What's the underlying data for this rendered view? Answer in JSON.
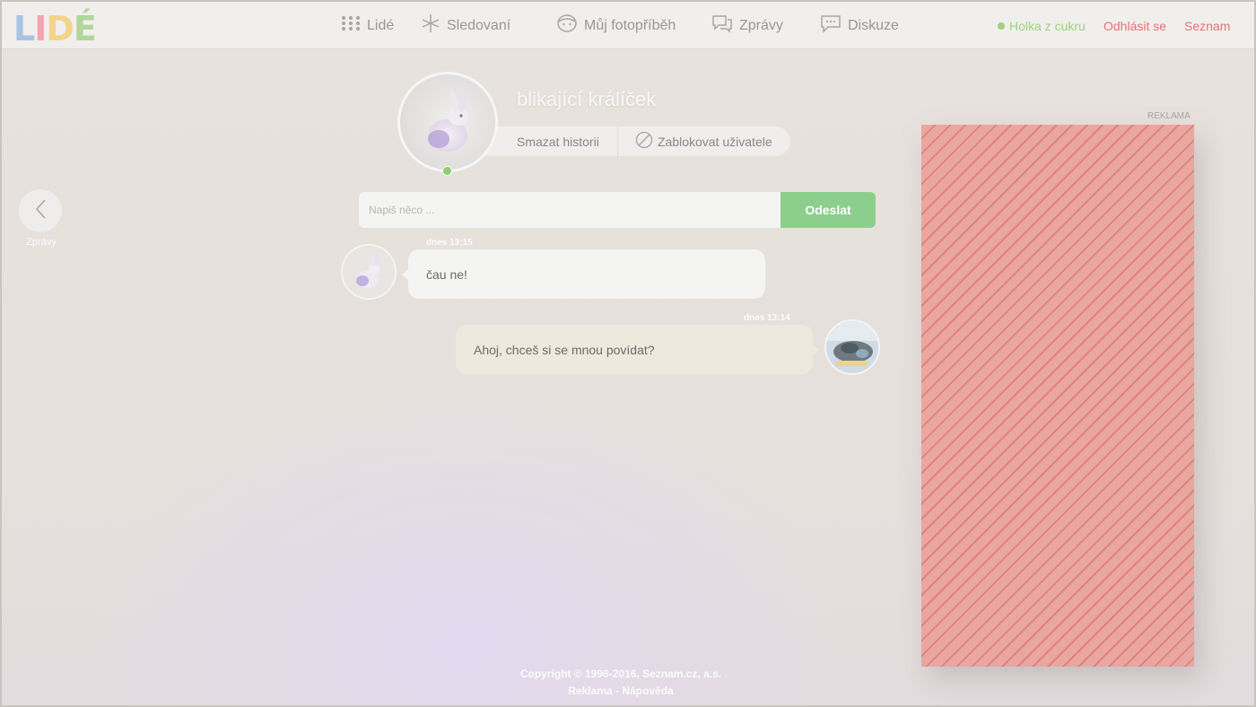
{
  "app": {
    "logo_text": "LIDÉ"
  },
  "nav": {
    "items": [
      {
        "label": "Lidé",
        "icon": "dots-grid-icon"
      },
      {
        "label": "Sledovaní",
        "icon": "star-icon"
      },
      {
        "label": "Můj fotopříběh",
        "icon": "face-icon"
      },
      {
        "label": "Zprávy",
        "icon": "chat-bubbles-icon"
      },
      {
        "label": "Diskuze",
        "icon": "discussion-icon"
      }
    ],
    "user_name": "Holka z cukru",
    "logout_label": "Odhlásit se",
    "seznam_label": "Seznam"
  },
  "back": {
    "label": "Zprávy",
    "icon": "chevron-left-icon"
  },
  "profile": {
    "name": "blikající králíček",
    "clear_history_label": "Smazat historii",
    "block_user_label": "Zablokovat uživatele",
    "block_icon": "block-icon",
    "online": true
  },
  "composer": {
    "placeholder": "Napiš něco ...",
    "send_label": "Odeslat"
  },
  "messages": [
    {
      "direction": "incoming",
      "time": "dnes 13:15",
      "text": "čau ne!"
    },
    {
      "direction": "outgoing",
      "time": "dnes 13:14",
      "text": "Ahoj, chceš si se mnou povídat?"
    }
  ],
  "ad": {
    "label": "REKLAMA"
  },
  "footer": {
    "copyright": "Copyright © 1996-2016, Seznam.cz, a.s.",
    "ads_link": "Reklama",
    "separator": " - ",
    "help_link": "Nápověda"
  },
  "colors": {
    "accent_green": "#8ccf8c",
    "link_red": "#ea7070",
    "online_green": "#9fd27d"
  }
}
